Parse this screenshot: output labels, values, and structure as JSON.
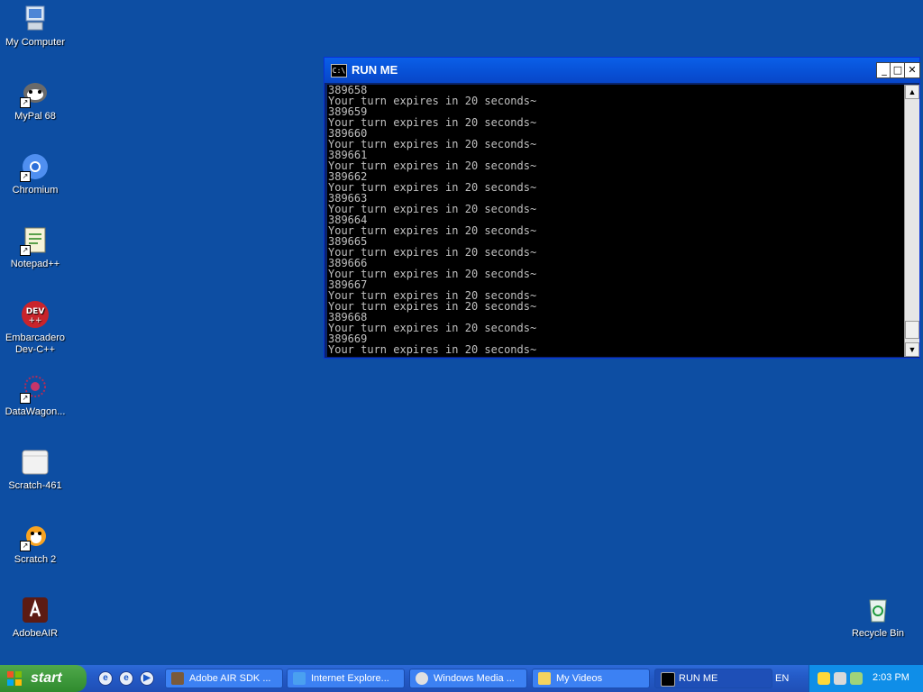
{
  "desktop_icons": [
    {
      "label": "My Computer"
    },
    {
      "label": "MyPal 68"
    },
    {
      "label": "Chromium"
    },
    {
      "label": "Notepad++"
    },
    {
      "label": "Embarcadero Dev-C++"
    },
    {
      "label": "DataWagon..."
    },
    {
      "label": "Scratch-461"
    },
    {
      "label": "Scratch 2"
    },
    {
      "label": "AdobeAIR"
    },
    {
      "label": "Recycle Bin"
    }
  ],
  "window": {
    "title": "RUN ME",
    "icon_text": "C:\\",
    "minimize": "_",
    "maximize": "□",
    "close": "✕",
    "lines": [
      "389658",
      "Your turn expires in 20 seconds~",
      "389659",
      "Your turn expires in 20 seconds~",
      "389660",
      "Your turn expires in 20 seconds~",
      "389661",
      "Your turn expires in 20 seconds~",
      "389662",
      "Your turn expires in 20 seconds~",
      "389663",
      "Your turn expires in 20 seconds~",
      "389664",
      "Your turn expires in 20 seconds~",
      "389665",
      "Your turn expires in 20 seconds~",
      "389666",
      "Your turn expires in 20 seconds~",
      "389667",
      "Your turn expires in 20 seconds~",
      "Your turn expires in 20 seconds~",
      "389668",
      "Your turn expires in 20 seconds~",
      "389669",
      "Your turn expires in 20 seconds~"
    ],
    "scroll_up": "▲",
    "scroll_down": "▼"
  },
  "taskbar": {
    "start_label": "start",
    "tasks": [
      {
        "label": "Adobe AIR SDK ..."
      },
      {
        "label": "Internet Explore..."
      },
      {
        "label": "Windows Media ..."
      },
      {
        "label": "My Videos"
      },
      {
        "label": "RUN ME"
      }
    ],
    "language": "EN",
    "clock": "2:03 PM"
  }
}
